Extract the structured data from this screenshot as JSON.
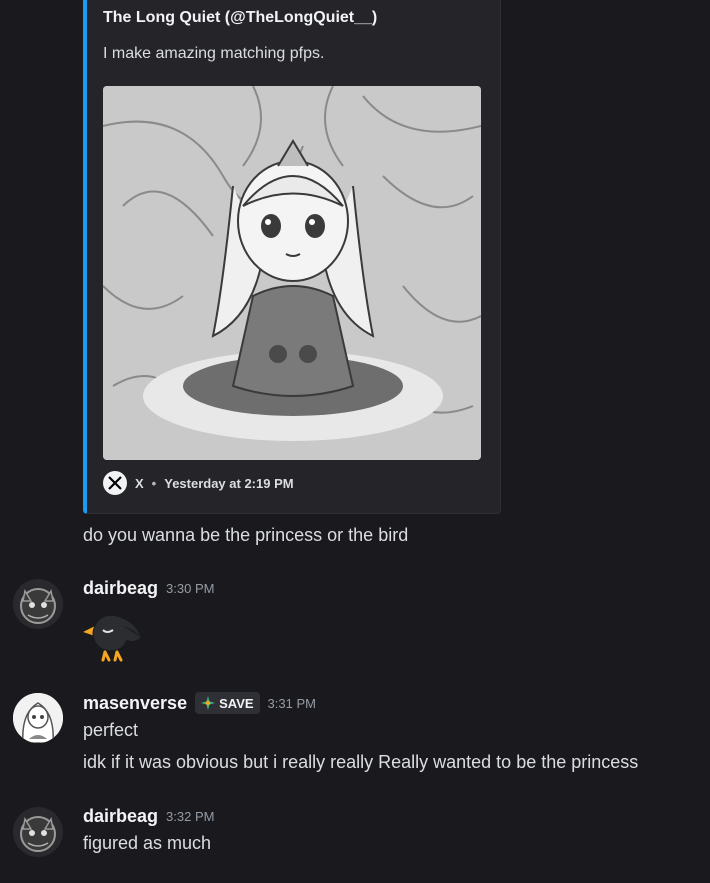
{
  "embed": {
    "author": "The Long Quiet (@TheLongQuiet__)",
    "description": "I make amazing matching pfps.",
    "footer_source": "X",
    "footer_separator": "•",
    "footer_time": "Yesterday at 2:19 PM",
    "accent_color": "#1d9bf0"
  },
  "messages": [
    {
      "text": "do you wanna be the princess or the bird"
    },
    {
      "username": "dairbeag",
      "timestamp": "3:30 PM",
      "content": "bird-emoji"
    },
    {
      "username": "masenverse",
      "tag": "SAVE",
      "timestamp": "3:31 PM",
      "lines": [
        "perfect",
        "idk if it was obvious but i really really Really wanted to be the princess"
      ]
    },
    {
      "username": "dairbeag",
      "timestamp": "3:32 PM",
      "lines": [
        "figured as much"
      ]
    }
  ]
}
